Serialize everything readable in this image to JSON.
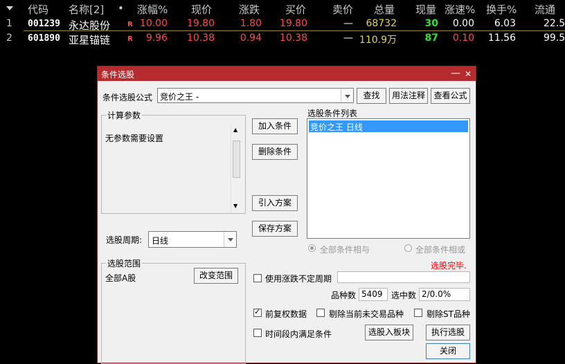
{
  "table": {
    "headers": {
      "code": "代码",
      "name": "名称[2]",
      "dot": "•",
      "change_pct": "涨幅%",
      "price": "现价",
      "change": "涨跌",
      "bid": "买价",
      "ask": "卖价",
      "volume": "总量",
      "cur_vol": "现量",
      "speed": "涨速%",
      "turnover": "换手%",
      "float": "流通"
    },
    "rows": [
      {
        "idx": "1",
        "code": "001239",
        "name": "永达股份",
        "flag": "R",
        "change_pct": "10.00",
        "price": "19.80",
        "change": "1.80",
        "bid": "19.80",
        "ask": "—",
        "volume": "68732",
        "cur_vol": "30",
        "speed": "0.00",
        "turnover": "6.03",
        "float": "22.5"
      },
      {
        "idx": "2",
        "code": "601890",
        "name": "亚星锚链",
        "flag": "R",
        "change_pct": "9.96",
        "price": "10.38",
        "change": "0.94",
        "bid": "10.38",
        "ask": "—",
        "volume": "110.9万",
        "cur_vol": "87",
        "speed": "0.10",
        "turnover": "11.56",
        "float": "99.5"
      }
    ]
  },
  "dialog": {
    "title": "条件选股",
    "minimize": "—",
    "close": "✕",
    "formula_label": "条件选股公式",
    "formula_value": "竞价之王  -",
    "find": "查找",
    "usage": "用法注释",
    "view_formula": "查看公式",
    "calc_params_title": "计算参数",
    "no_params": "无参数需要设置",
    "period_label": "选股周期:",
    "period_value": "日线",
    "add_condition": "加入条件",
    "delete_condition": "删除条件",
    "import_plan": "引入方案",
    "save_plan": "保存方案",
    "cond_list_title": "选股条件列表",
    "cond_items": [
      "竞价之王  日线"
    ],
    "radio_and": "全部条件相与",
    "radio_or": "全部条件相或",
    "status": "选股完毕.",
    "range_title": "选股范围",
    "range_value": "全部A股",
    "change_range": "改变范围",
    "use_period_label": "使用涨跌不定周期",
    "count_label": "品种数",
    "count_value": "5409",
    "selected_label": "选中数",
    "selected_value": "2/0.0%",
    "adj_data": "前复权数据",
    "exclude_untraded": "剔除当前未交易品种",
    "exclude_st": "剔除ST品种",
    "time_range": "时间段内满足条件",
    "to_block": "选股入板块",
    "execute": "执行选股",
    "close_btn": "关闭",
    "colors": {
      "titlebar": "#b52b2e",
      "selection": "#3399ff",
      "status": "#ff0000"
    }
  }
}
